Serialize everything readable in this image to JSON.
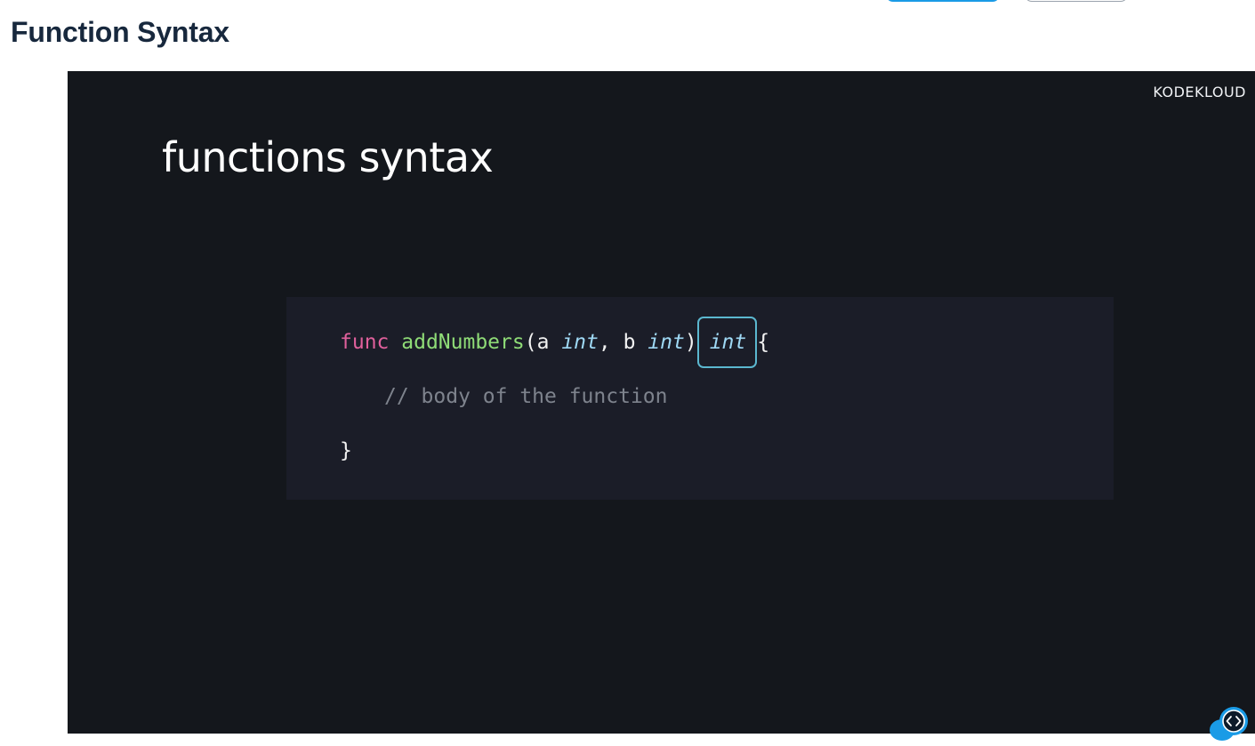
{
  "page": {
    "title": "Function Syntax"
  },
  "slide": {
    "brand": "KODEKLOUD",
    "title": "functions syntax",
    "code": {
      "line1": {
        "keyword": "func",
        "function_name": "addNumbers",
        "open_paren": "(",
        "param_a": "a",
        "type_a": "int",
        "comma": ", ",
        "param_b": "b",
        "type_b": "int",
        "close_paren": ")",
        "return_type": "int",
        "open_brace": "{"
      },
      "line2": {
        "comment": "// body of the function"
      },
      "line3": {
        "close_brace": "}"
      }
    }
  },
  "overlay": {
    "icon": "code-embed-icon"
  },
  "colors": {
    "title": "#17283d",
    "video_bg": "#14171c",
    "code_bg": "#1b1d28",
    "keyword": "#e0609c",
    "function_name": "#8fdc77",
    "type": "#9fd9f5",
    "comment": "#7e838d",
    "highlight_border": "#5bb7cf",
    "accent": "#1a9be6"
  }
}
